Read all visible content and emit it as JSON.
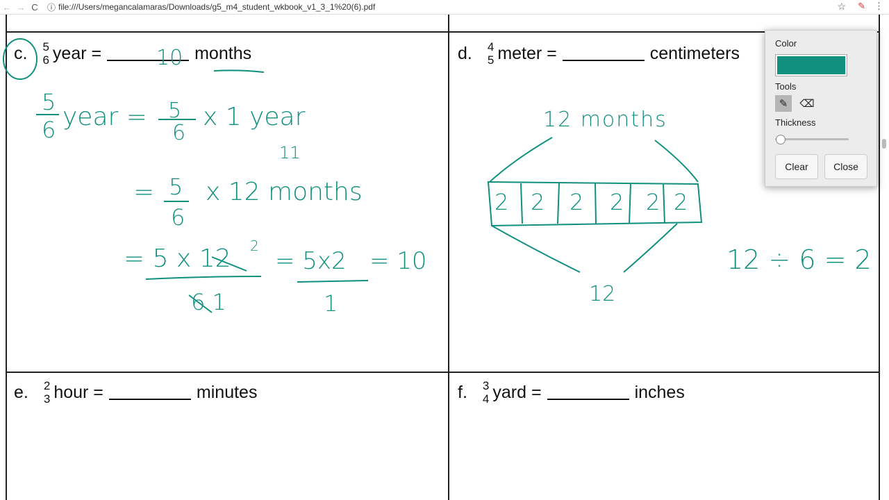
{
  "browser": {
    "back": "←",
    "forward": "→",
    "reload": "C",
    "info": "ⓘ",
    "url": "file:///Users/megancalamaras/Downloads/g5_m4_student_wkbook_v1_3_1%20(6).pdf",
    "star": "☆",
    "pen": "✎",
    "menu": "⋮"
  },
  "problems": [
    {
      "label": "c.",
      "num": "5",
      "den": "6",
      "unit": "year =",
      "target": "months"
    },
    {
      "label": "d.",
      "num": "4",
      "den": "5",
      "unit": "meter =",
      "target": "centimeters"
    },
    {
      "label": "e.",
      "num": "2",
      "den": "3",
      "unit": "hour =",
      "target": "minutes"
    },
    {
      "label": "f.",
      "num": "3",
      "den": "4",
      "unit": "yard =",
      "target": "inches"
    }
  ],
  "handwriting": {
    "answer_c": "10",
    "c_line1_num": "5",
    "c_line1_den": "6",
    "c_line1_a": "year =",
    "c_line1_num2": "5",
    "c_line1_den2": "6",
    "c_line1_b": "x  1 year",
    "c_eq": "11",
    "c_line2_num": "5",
    "c_line2_den": "6",
    "c_line2": "= ",
    "c_line2_b": "x 12 months",
    "c_line3_a": "= 5 x 12",
    "c_line3_sup": "2",
    "c_line3_den": "6 1",
    "c_line3_b": "= 5x2",
    "c_line3_den2": "1",
    "c_line3_c": "= 10",
    "d_top": "12 months",
    "d_boxes": [
      "2",
      "2",
      "2",
      "2",
      "2",
      "2"
    ],
    "d_bottom": "12",
    "d_division": "12 ÷ 6 = 2"
  },
  "ink_color": "#12907f",
  "annotation_panel": {
    "color_label": "Color",
    "selected_color": "#12907f",
    "tools_label": "Tools",
    "tools": [
      {
        "name": "pencil",
        "icon": "✎",
        "selected": true
      },
      {
        "name": "eraser",
        "icon": "⌫",
        "selected": false
      }
    ],
    "thickness_label": "Thickness",
    "thickness": 0.05,
    "clear": "Clear",
    "close": "Close"
  }
}
